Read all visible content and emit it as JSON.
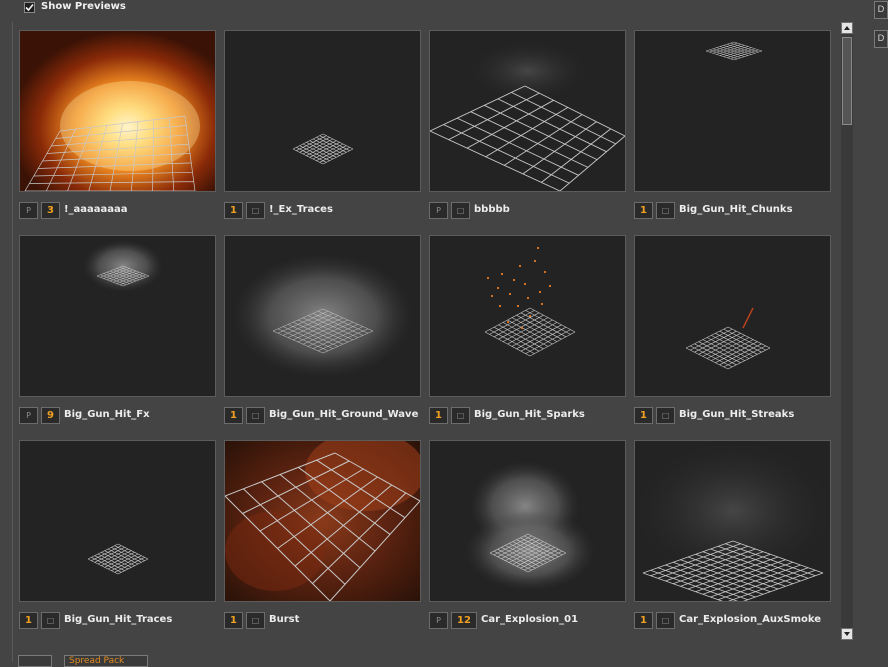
{
  "header": {
    "show_previews_label": "Show Previews",
    "show_previews_checked": true
  },
  "side_buttons": [
    "D",
    "D"
  ],
  "bottom_buttons": [
    "",
    "Spread Pack"
  ],
  "items": [
    {
      "name": "!_aaaaaaaa",
      "count": "3",
      "flag": "P",
      "preview": "fire-explosion"
    },
    {
      "name": "!_Ex_Traces",
      "count": "1",
      "flag": "",
      "preview": "small-grid"
    },
    {
      "name": "bbbbb",
      "count": "",
      "flag": "P",
      "preview": "large-grid"
    },
    {
      "name": "Big_Gun_Hit_Chunks",
      "count": "1",
      "flag": "",
      "preview": "tiny-grid-top"
    },
    {
      "name": "Big_Gun_Hit_Fx",
      "count": "9",
      "flag": "P",
      "preview": "smoke-puff-small"
    },
    {
      "name": "Big_Gun_Hit_Ground_Wave",
      "count": "1",
      "flag": "",
      "preview": "smoke-wave"
    },
    {
      "name": "Big_Gun_Hit_Sparks",
      "count": "1",
      "flag": "",
      "preview": "sparks"
    },
    {
      "name": "Big_Gun_Hit_Streaks",
      "count": "1",
      "flag": "",
      "preview": "streak"
    },
    {
      "name": "Big_Gun_Hit_Traces",
      "count": "1",
      "flag": "",
      "preview": "small-grid"
    },
    {
      "name": "Burst",
      "count": "1",
      "flag": "",
      "preview": "red-burst"
    },
    {
      "name": "Car_Explosion_01",
      "count": "12",
      "flag": "P",
      "preview": "smoke-column"
    },
    {
      "name": "Car_Explosion_AuxSmoke",
      "count": "1",
      "flag": "",
      "preview": "haze-grid"
    }
  ],
  "colors": {
    "accent_orange": "#f0a020",
    "background": "#444444",
    "thumb_bg": "#232323"
  }
}
